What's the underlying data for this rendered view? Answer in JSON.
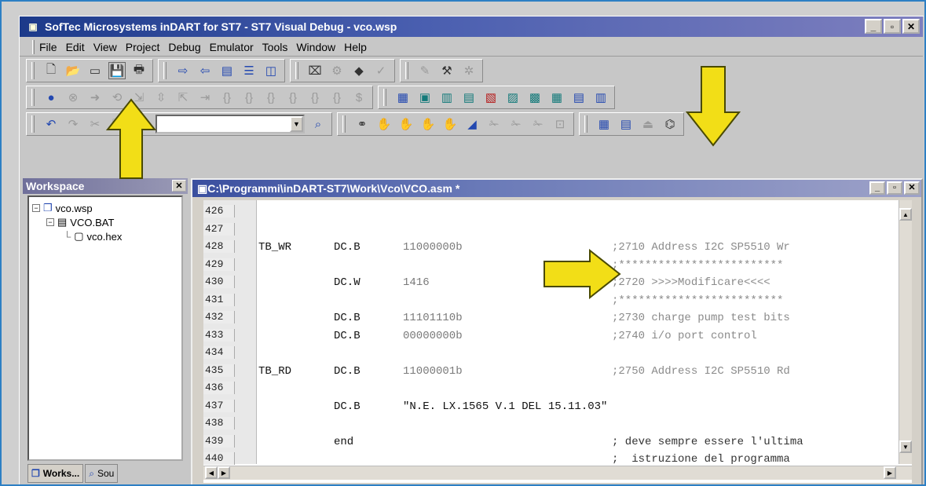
{
  "window": {
    "title": "SofTec Microsystems inDART for ST7 - ST7 Visual Debug - vco.wsp",
    "buttons": [
      "_",
      "▫",
      "✕"
    ]
  },
  "menu": [
    "File",
    "Edit",
    "View",
    "Project",
    "Debug",
    "Emulator",
    "Tools",
    "Window",
    "Help"
  ],
  "workspace": {
    "title": "Workspace",
    "tree": [
      {
        "label": "vco.wsp",
        "icon": "workspace-icon"
      },
      {
        "label": "VCO.BAT",
        "icon": "project-icon"
      },
      {
        "label": "vco.hex",
        "icon": "file-icon"
      }
    ],
    "tabs": [
      "Works...",
      "Sou"
    ]
  },
  "editor": {
    "title": "C:\\Programmi\\inDART-ST7\\Work\\Vco\\VCO.asm *",
    "lines": [
      {
        "n": "426",
        "label": "",
        "dir": "",
        "val": "",
        "cmt": ""
      },
      {
        "n": "427",
        "label": "",
        "dir": "",
        "val": "",
        "cmt": ""
      },
      {
        "n": "428",
        "label": "TB_WR",
        "dir": "DC.B",
        "val": "11000000b",
        "cmt": ";2710 Address I2C SP5510 Wr"
      },
      {
        "n": "429",
        "label": "",
        "dir": "",
        "val": "",
        "cmt": ";*************************"
      },
      {
        "n": "430",
        "label": "",
        "dir": "DC.W",
        "val": "1416",
        "cmt": ";2720 >>>>Modificare<<<<"
      },
      {
        "n": "431",
        "label": "",
        "dir": "",
        "val": "",
        "cmt": ";*************************"
      },
      {
        "n": "432",
        "label": "",
        "dir": "DC.B",
        "val": "11101110b",
        "cmt": ";2730 charge pump test bits"
      },
      {
        "n": "433",
        "label": "",
        "dir": "DC.B",
        "val": "00000000b",
        "cmt": ";2740 i/o port control"
      },
      {
        "n": "434",
        "label": "",
        "dir": "",
        "val": "",
        "cmt": ""
      },
      {
        "n": "435",
        "label": "TB_RD",
        "dir": "DC.B",
        "val": "11000001b",
        "cmt": ";2750 Address I2C SP5510 Rd"
      },
      {
        "n": "436",
        "label": "",
        "dir": "",
        "val": "",
        "cmt": ""
      },
      {
        "n": "437",
        "label": "",
        "dir": "DC.B",
        "val": "\"N.E. LX.1565 V.1 DEL 15.11.03\"",
        "cmt": ""
      },
      {
        "n": "438",
        "label": "",
        "dir": "",
        "val": "",
        "cmt": ""
      },
      {
        "n": "439",
        "label": "",
        "dir": "end",
        "val": "",
        "cmt": "; deve sempre essere l'ultima"
      },
      {
        "n": "440",
        "label": "",
        "dir": "",
        "val": "",
        "cmt": ";  istruzione del programma"
      }
    ]
  },
  "colors": {
    "arrow": "#f2de17",
    "arrow_outline": "#4a4a00",
    "frame_border": "#2d7fc4"
  }
}
